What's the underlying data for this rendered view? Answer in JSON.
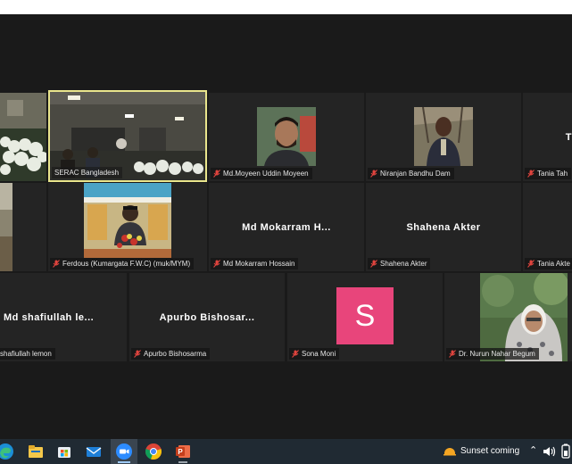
{
  "tiles": {
    "r1c0": {
      "name": ""
    },
    "r1c1": {
      "name": "SERAC Bangladesh"
    },
    "r1c2": {
      "name": "Md.Moyeen Uddin Moyeen"
    },
    "r1c3": {
      "name": "Niranjan Bandhu Dam"
    },
    "r1c4": {
      "name": "Tania Tah",
      "big": "T"
    },
    "r2c0": {
      "name": ""
    },
    "r2c1": {
      "name": "Ferdous (Kumargata F.W.C) (muk/MYM)"
    },
    "r2c2": {
      "name": "Md Mokarram Hossain",
      "big": "Md  Mokarram  H..."
    },
    "r2c3": {
      "name": "Shahena Akter",
      "big": "Shahena  Akter"
    },
    "r2c4": {
      "name": "Tania Akte"
    },
    "r3c0": {
      "name": "shafiullah lemon",
      "big": "Md  shafiullah  le..."
    },
    "r3c1": {
      "name": "Apurbo Bishosarma",
      "big": "Apurbo  Bishosar..."
    },
    "r3c2": {
      "name": "Sona Moni",
      "initial": "S"
    },
    "r3c3": {
      "name": "Dr. Nurun Nahar Begum"
    }
  },
  "taskbar": {
    "weather": "Sunset coming",
    "icons": [
      "edge-icon",
      "file-explorer-icon",
      "store-icon",
      "mail-icon",
      "zoom-icon",
      "chrome-icon",
      "powerpoint-icon"
    ]
  },
  "colors": {
    "active_border": "#e9e58c",
    "avatar_s": "#e8457b",
    "mute_red": "#e0443e"
  }
}
